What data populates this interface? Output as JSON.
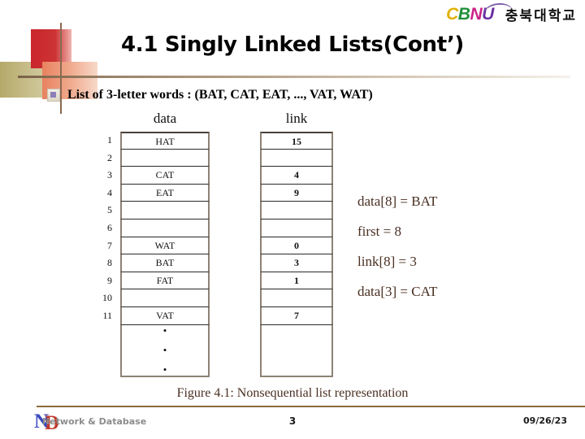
{
  "brand": {
    "acronym_letters": [
      "C",
      "B",
      "N",
      "U"
    ],
    "korean_name": "충북대학교",
    "colors": {
      "c": "#e0b000",
      "b": "#1f8f3a",
      "n": "#cc2288",
      "u": "#6a2fa0"
    }
  },
  "slide": {
    "title": "4.1 Singly Linked Lists(Cont’)",
    "bullet": {
      "icon": "cube-bullet-icon",
      "text": "List of 3-letter words : (BAT, CAT, EAT, ..., VAT, WAT)"
    }
  },
  "figure": {
    "headers": {
      "data": "data",
      "link": "link"
    },
    "rows": [
      {
        "index": "1",
        "data": "HAT",
        "link": "15"
      },
      {
        "index": "2",
        "data": "",
        "link": ""
      },
      {
        "index": "3",
        "data": "CAT",
        "link": "4"
      },
      {
        "index": "4",
        "data": "EAT",
        "link": "9"
      },
      {
        "index": "5",
        "data": "",
        "link": ""
      },
      {
        "index": "6",
        "data": "",
        "link": ""
      },
      {
        "index": "7",
        "data": "WAT",
        "link": "0"
      },
      {
        "index": "8",
        "data": "BAT",
        "link": "3"
      },
      {
        "index": "9",
        "data": "FAT",
        "link": "1"
      },
      {
        "index": "10",
        "data": "",
        "link": ""
      },
      {
        "index": "11",
        "data": "VAT",
        "link": "7"
      }
    ],
    "continuation_dots": [
      "•",
      "•",
      "•"
    ],
    "caption": "Figure 4.1: Nonsequential list representation"
  },
  "annotations": [
    "data[8] = BAT",
    "first = 8",
    "link[8] = 3",
    "data[3] = CAT"
  ],
  "footer": {
    "logo_letters": {
      "n": "N",
      "d": "D"
    },
    "text": "Network & Database",
    "page_number": "3",
    "date": "09/26/23"
  }
}
